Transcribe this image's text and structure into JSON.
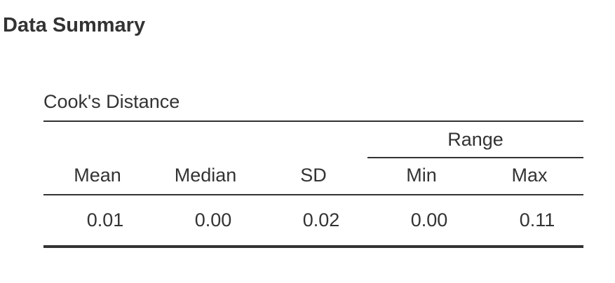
{
  "page": {
    "title": "Data Summary"
  },
  "table": {
    "caption": "Cook's Distance",
    "spanner": "Range",
    "headers": [
      "Mean",
      "Median",
      "SD",
      "Min",
      "Max"
    ],
    "rows": [
      [
        "0.01",
        "0.00",
        "0.02",
        "0.00",
        "0.11"
      ]
    ]
  }
}
